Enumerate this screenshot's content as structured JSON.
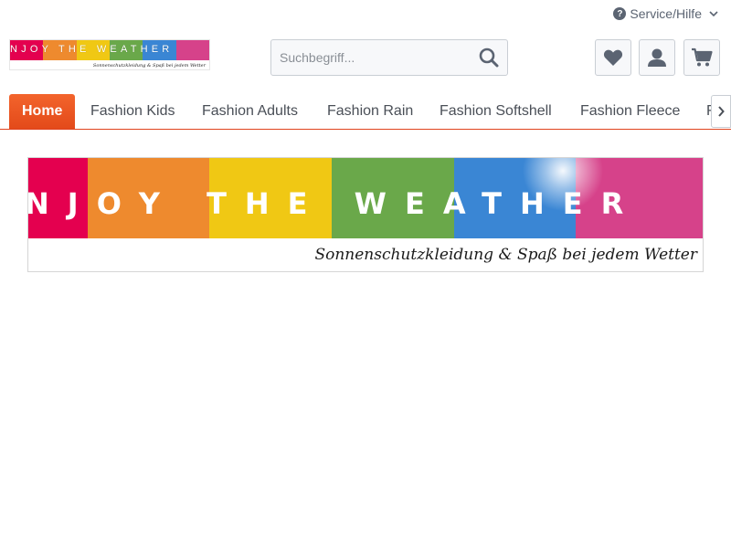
{
  "header": {
    "service_label": "Service/Hilfe",
    "service_icon": "question-circle-icon",
    "logo_word": "NJOY THE WEATHER",
    "logo_tagline": "Sonnenschutzkleidung & Spaß bei jedem Wetter"
  },
  "search": {
    "placeholder": "Suchbegriff...",
    "value": ""
  },
  "actions": {
    "wishlist_icon": "heart-icon",
    "account_icon": "user-icon",
    "cart_icon": "cart-icon"
  },
  "nav": {
    "items": [
      {
        "label": "Home",
        "active": true
      },
      {
        "label": "Fashion Kids",
        "active": false
      },
      {
        "label": "Fashion Adults",
        "active": false
      },
      {
        "label": "Fashion Rain",
        "active": false
      },
      {
        "label": "Fashion Softshell",
        "active": false
      },
      {
        "label": "Fashion Fleece",
        "active": false
      },
      {
        "label": "F",
        "active": false
      }
    ]
  },
  "banner": {
    "word": "NJOY THE WEATHER",
    "tagline": "Sonnenschutzkleidung & Spaß bei jedem Wetter"
  },
  "colors": {
    "accent": "#e84e1b",
    "stripe_red": "#e4004f",
    "stripe_orange": "#ee8a2e",
    "stripe_yellow": "#f0c814",
    "stripe_green": "#6aa84a",
    "stripe_blue": "#3a86d4",
    "stripe_pink": "#d6428a"
  }
}
